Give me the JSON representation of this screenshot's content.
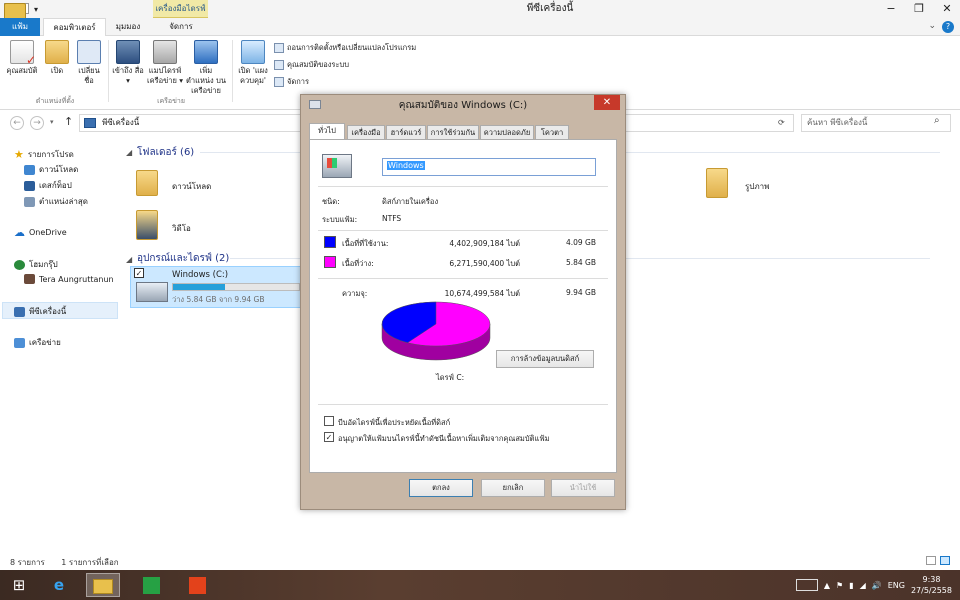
{
  "window": {
    "title": "พีซีเครื่องนี้",
    "context_tab": "เครื่องมือไดรฟ์",
    "controls": [
      "minimize",
      "restore",
      "close"
    ]
  },
  "ribbon": {
    "tabs": [
      {
        "label": "แฟ้ม",
        "active": false
      },
      {
        "label": "คอมพิวเตอร์",
        "active": true
      },
      {
        "label": "มุมมอง",
        "active": false
      },
      {
        "label": "จัดการ",
        "active": false
      }
    ],
    "groups": {
      "location": {
        "label": "ตำแหน่งที่ตั้ง",
        "buttons": [
          {
            "label": "คุณสมบัติ",
            "icon": "properties-icon"
          },
          {
            "label": "เปิด",
            "icon": "open-icon"
          },
          {
            "label": "เปลี่ยน ชื่อ",
            "icon": "rename-icon"
          }
        ]
      },
      "network": {
        "label": "เครือข่าย",
        "buttons": [
          {
            "label": "เข้าถึง สื่อ ▾",
            "icon": "media-icon"
          },
          {
            "label": "แมปไดรฟ์ เครือข่าย ▾",
            "icon": "map-drive-icon"
          },
          {
            "label": "เพิ่มตำแหน่ง บนเครือข่าย",
            "icon": "network-location-icon"
          }
        ]
      },
      "system": {
        "label": "ระบบ",
        "open_settings": "เปิด 'แผง ควบคุม'",
        "items": [
          "ถอนการติดตั้งหรือเปลี่ยนแปลงโปรแกรม",
          "คุณสมบัติของระบบ",
          "จัดการ"
        ]
      }
    }
  },
  "address": {
    "path": "พีซีเครื่องนี้",
    "search_placeholder": "ค้นหา พีซีเครื่องนี้"
  },
  "nav_pane": {
    "favorites": "รายการโปรด",
    "fav_items": [
      "ดาวน์โหลด",
      "เดสก์ท็อป",
      "ตำแหน่งล่าสุด"
    ],
    "onedrive": "OneDrive",
    "homegroup": "โฮมกรุ๊ป",
    "homegroup_user": "Tera Aungruttanun",
    "this_pc": "พีซีเครื่องนี้",
    "network": "เครือข่าย"
  },
  "content": {
    "folders_header": "โฟลเดอร์ (6)",
    "folders": [
      "ดาวน์โหลด",
      "วิดีโอ",
      "รูปภาพ"
    ],
    "devices_header": "อุปกรณ์และไดรฟ์ (2)",
    "drive": {
      "name": "Windows (C:)",
      "space": "ว่าง 5.84 GB จาก 9.94 GB",
      "used_fraction": 0.41
    }
  },
  "status": {
    "items": "8 รายการ",
    "selected": "1 รายการที่เลือก"
  },
  "dialog": {
    "title": "คุณสมบัติของ Windows (C:)",
    "close_label": "✕",
    "tabs": [
      {
        "label": "ทั่วไป",
        "active": true
      },
      {
        "label": "เครื่องมือ",
        "active": false
      },
      {
        "label": "ฮาร์ดแวร์",
        "active": false
      },
      {
        "label": "การใช้ร่วมกัน",
        "active": false
      },
      {
        "label": "ความปลอดภัย",
        "active": false
      },
      {
        "label": "โควตา",
        "active": false
      }
    ],
    "drive_name_value": "Windows",
    "type_label": "ชนิด:",
    "type_value": "ดิสก์ภายในเครื่อง",
    "fs_label": "ระบบแฟ้ม:",
    "fs_value": "NTFS",
    "used": {
      "label": "เนื้อที่ที่ใช้งาน:",
      "bytes": "4,402,909,184 ไบต์",
      "size": "4.09 GB",
      "color": "#0000ff"
    },
    "free": {
      "label": "เนื้อที่ว่าง:",
      "bytes": "6,271,590,400 ไบต์",
      "size": "5.84 GB",
      "color": "#ff00ff"
    },
    "capacity": {
      "label": "ความจุ:",
      "bytes": "10,674,499,584 ไบต์",
      "size": "9.94 GB"
    },
    "pie_used_fraction": 0.412,
    "drive_letter_label": "ไดรฟ์ C:",
    "cleanup_button": "การล้างข้อมูลบนดิสก์",
    "compress_checkbox": {
      "label": "บีบอัดไดรฟ์นี้เพื่อประหยัดเนื้อที่ดิสก์",
      "checked": false
    },
    "index_checkbox": {
      "label": "อนุญาตให้แฟ้มบนไดรฟ์นี้ทำดัชนีเนื้อหาเพิ่มเติมจากคุณสมบัติแฟ้ม",
      "checked": true
    },
    "ok_button": "ตกลง",
    "cancel_button": "ยกเลิก",
    "apply_button": "นำไปใช้"
  },
  "taskbar": {
    "language": "ENG",
    "time": "9:38",
    "date": "27/5/2558"
  }
}
